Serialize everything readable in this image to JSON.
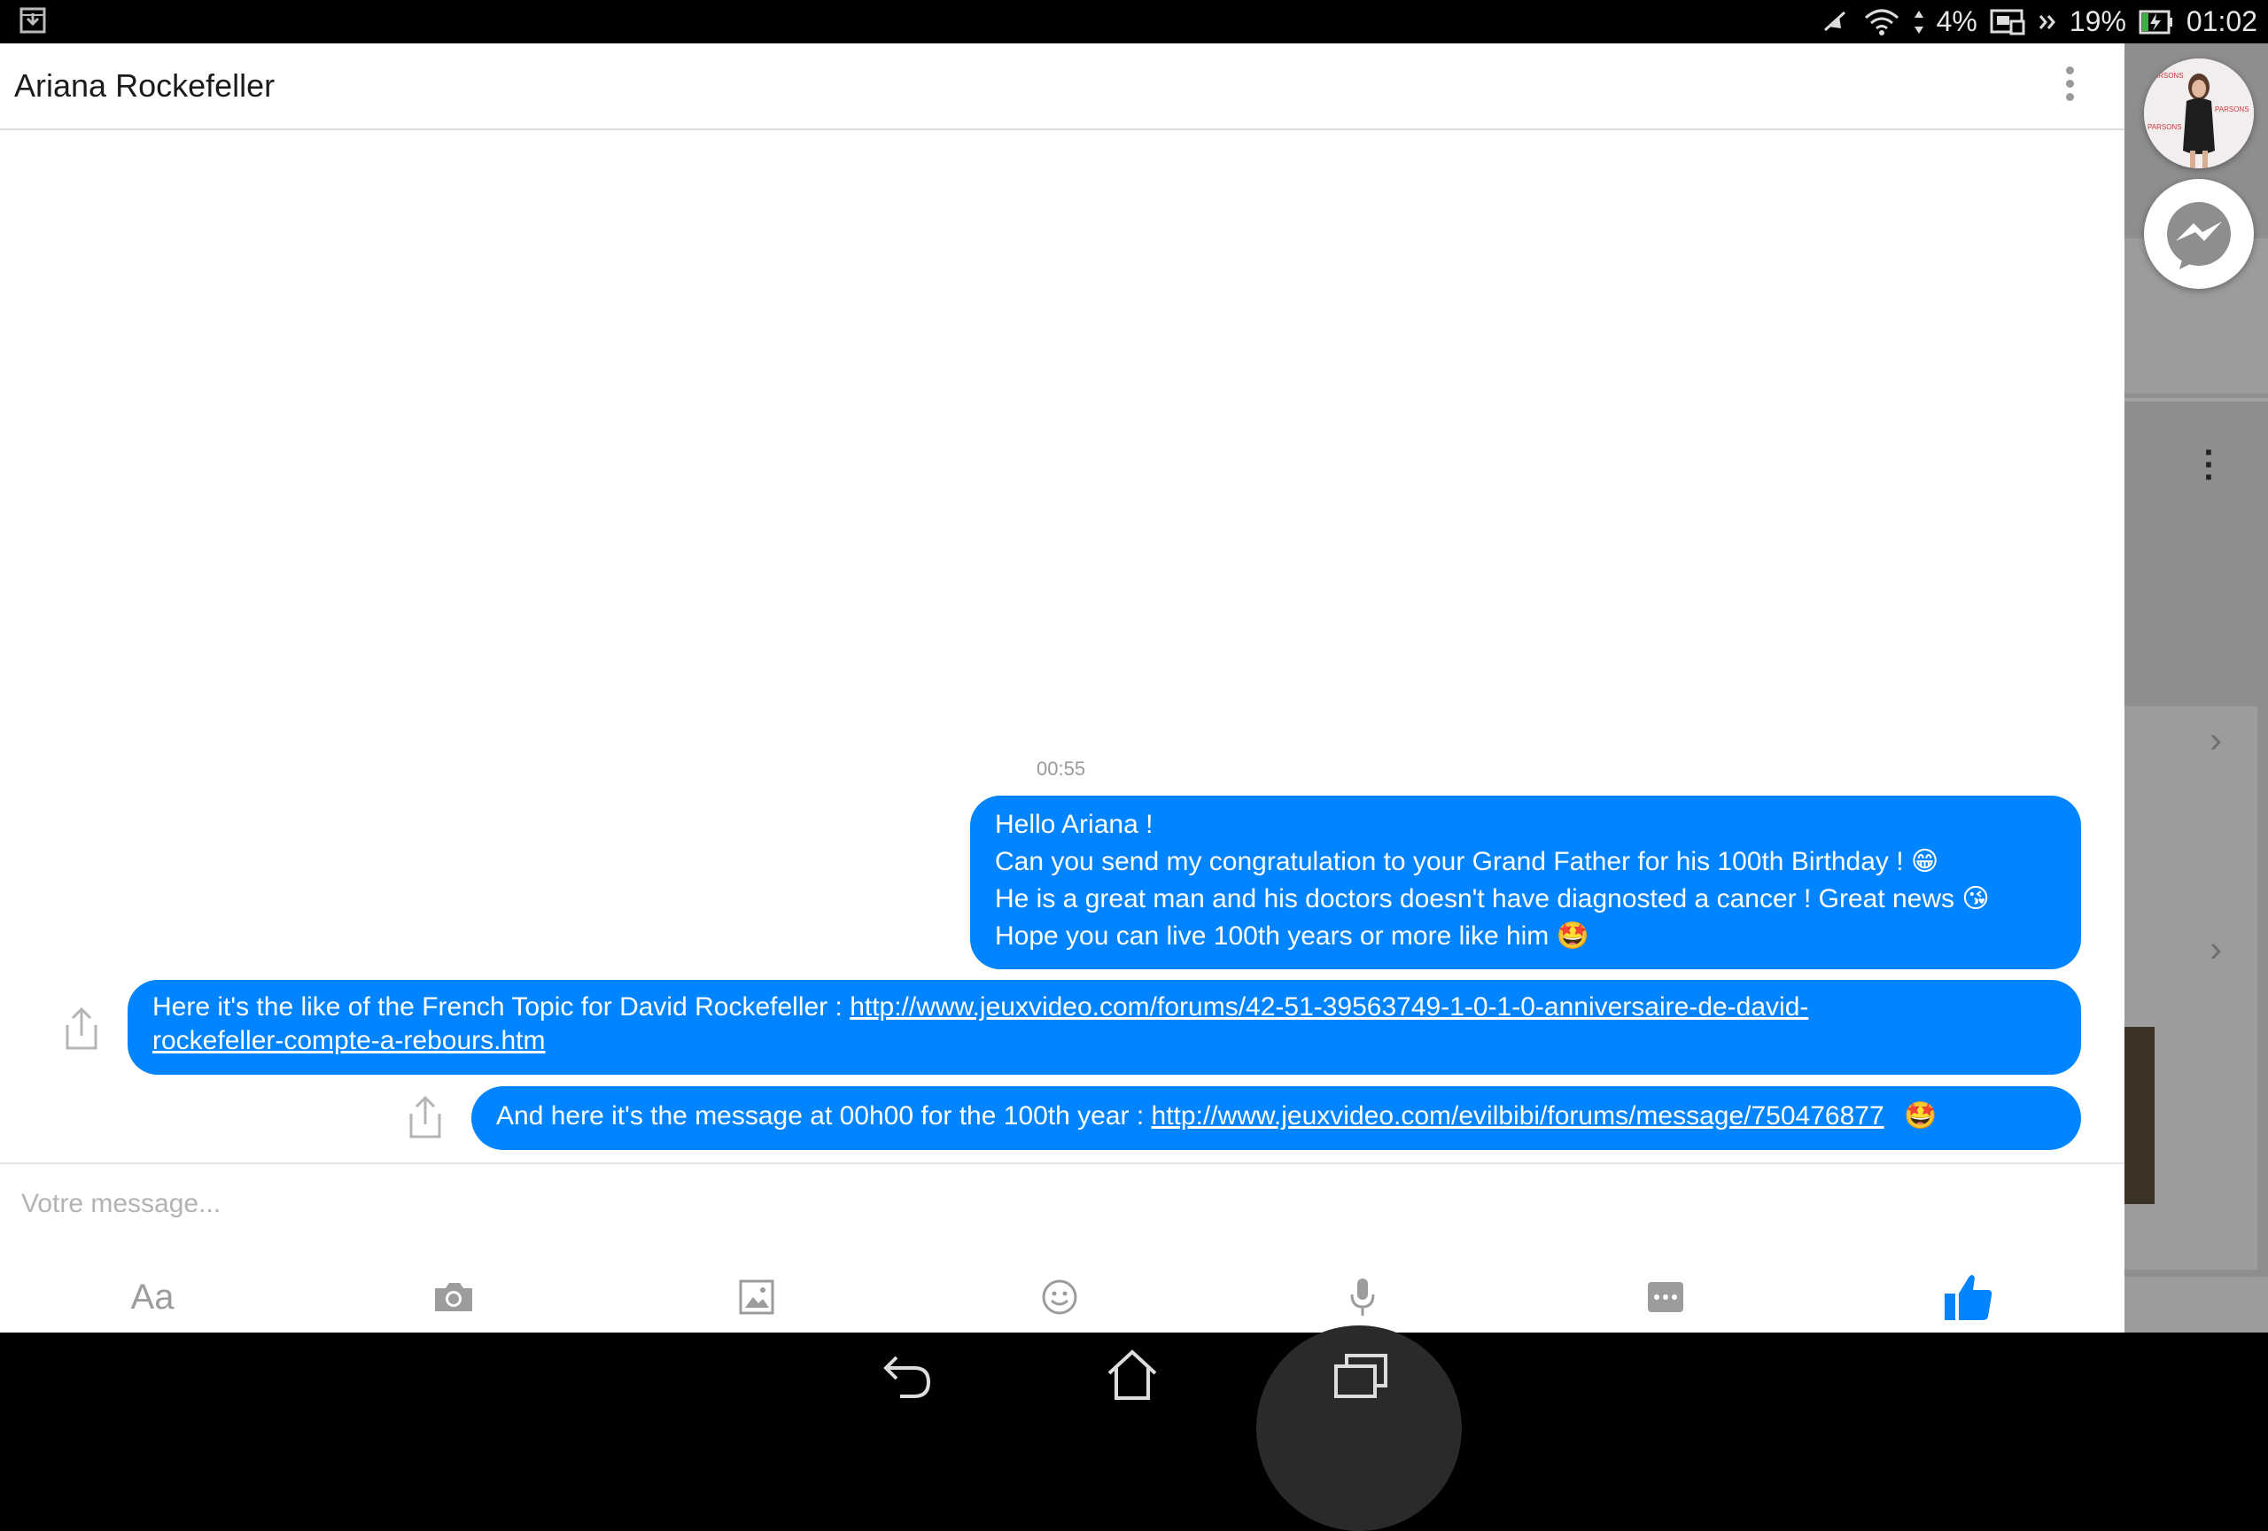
{
  "status_bar": {
    "data_percent": "4%",
    "battery_percent": "19%",
    "time": "01:02"
  },
  "chat": {
    "contact_name": "Ariana Rockefeller",
    "timestamp": "00:55",
    "messages": [
      {
        "lines": [
          "Hello Ariana !",
          "Can you send my congratulation to your Grand Father for his 100th Birthday ! 😁",
          "He is a great man and his doctors doesn't have diagnosted a cancer ! Great news 😘",
          "Hope you can live 100th years or more like him 🤩"
        ]
      },
      {
        "text": "Here it's the like of the French Topic for David Rockefeller : ",
        "link_line1": "http://www.jeuxvideo.com/forums/42-51-39563749-1-0-1-0-anniversaire-de-david-",
        "link_line2": "rockefeller-compte-a-rebours.htm"
      },
      {
        "text": "And here it's the message at 00h00 for the 100th year : ",
        "link": "http://www.jeuxvideo.com/evilbibi/forums/message/750476877",
        "emoji": "🤩"
      }
    ]
  },
  "composer": {
    "placeholder": "Votre message...",
    "text_format_label": "Aa"
  },
  "colors": {
    "bubble": "#0084ff",
    "like": "#0084ff",
    "icon_gray": "#9c9c9c"
  }
}
